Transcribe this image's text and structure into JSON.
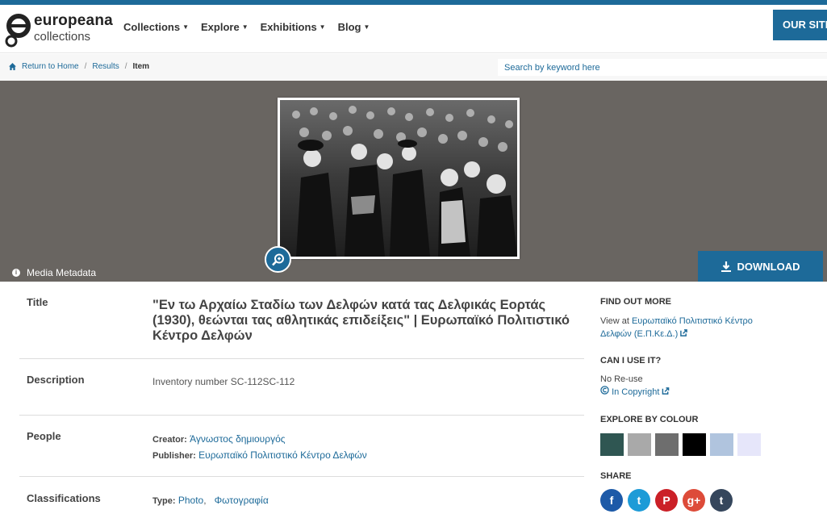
{
  "header": {
    "logo": {
      "line1": "europeana",
      "line2": "collections"
    },
    "nav": [
      {
        "label": "Collections"
      },
      {
        "label": "Explore"
      },
      {
        "label": "Exhibitions"
      },
      {
        "label": "Blog"
      }
    ],
    "our_sites": "OUR SITES"
  },
  "breadcrumb": {
    "home": "Return to Home",
    "results": "Results",
    "current": "Item",
    "separator": "/"
  },
  "search": {
    "placeholder": "Search by keyword here",
    "value": ""
  },
  "media": {
    "metadata_label": "Media Metadata",
    "download_label": "DOWNLOAD"
  },
  "fields": {
    "title": {
      "label": "Title",
      "value": "\"Εν τω Αρχαίω Σταδίω των Δελφών κατά τας Δελφικάς Εορτάς (1930), θεώνται τας αθλητικάς επιδείξεις\" | Ευρωπαϊκό Πολιτιστικό Κέντρο Δελφών"
    },
    "description": {
      "label": "Description",
      "value": "Inventory number SC-112SC-112"
    },
    "people": {
      "label": "People",
      "creator_key": "Creator:",
      "creator_value": "Άγνωστος δημιουργός",
      "publisher_key": "Publisher:",
      "publisher_value": "Ευρωπαϊκό Πολιτιστικό Κέντρο Δελφών"
    },
    "classifications": {
      "label": "Classifications",
      "type_key": "Type:",
      "type_value1": "Photo",
      "type_sep": ",",
      "type_value2": "Φωτογραφία"
    }
  },
  "sidebar": {
    "find_out_more": {
      "heading": "FIND OUT MORE",
      "view_at": "View at",
      "link": "Ευρωπαϊκό Πολιτιστικό Κέντρο Δελφών (Ε.Π.Κε.Δ.)"
    },
    "can_i_use": {
      "heading": "CAN I USE IT?",
      "status": "No Re-use",
      "rights_link": "In Copyright"
    },
    "explore_colour": {
      "heading": "EXPLORE BY COLOUR",
      "swatches": [
        "#2f5652",
        "#a9a9a9",
        "#6e6e6e",
        "#000000",
        "#b0c4de",
        "#e6e6fa"
      ]
    },
    "share": {
      "heading": "SHARE",
      "networks": [
        {
          "icon": "facebook-icon",
          "glyph": "f",
          "color": "#1d5aa8"
        },
        {
          "icon": "twitter-icon",
          "glyph": "t",
          "color": "#1d9bd7"
        },
        {
          "icon": "pinterest-icon",
          "glyph": "P",
          "color": "#cb2027"
        },
        {
          "icon": "google-plus-icon",
          "glyph": "g+",
          "color": "#dd4b39"
        },
        {
          "icon": "tumblr-icon",
          "glyph": "t",
          "color": "#35465c"
        }
      ]
    }
  },
  "colors": {
    "accent": "#1d6a99",
    "media_bg": "#696561"
  }
}
